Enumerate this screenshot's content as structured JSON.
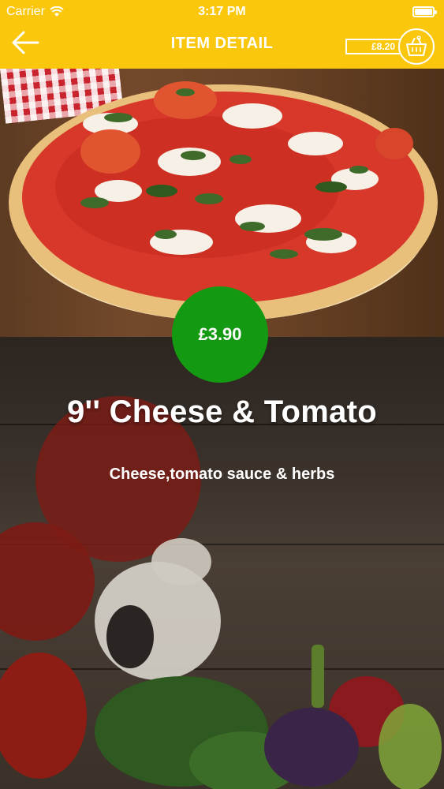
{
  "status_bar": {
    "carrier": "Carrier",
    "time": "3:17 PM"
  },
  "header": {
    "title": "ITEM DETAIL",
    "cart_total": "£8.20",
    "back_icon": "arrow-left-icon",
    "basket_icon": "basket-icon"
  },
  "item": {
    "price": "£3.90",
    "name": "9'' Cheese & Tomato",
    "description": "Cheese,tomato sauce & herbs"
  },
  "colors": {
    "header_bg": "#fbc70d",
    "price_badge": "#149a12",
    "text": "#ffffff"
  }
}
